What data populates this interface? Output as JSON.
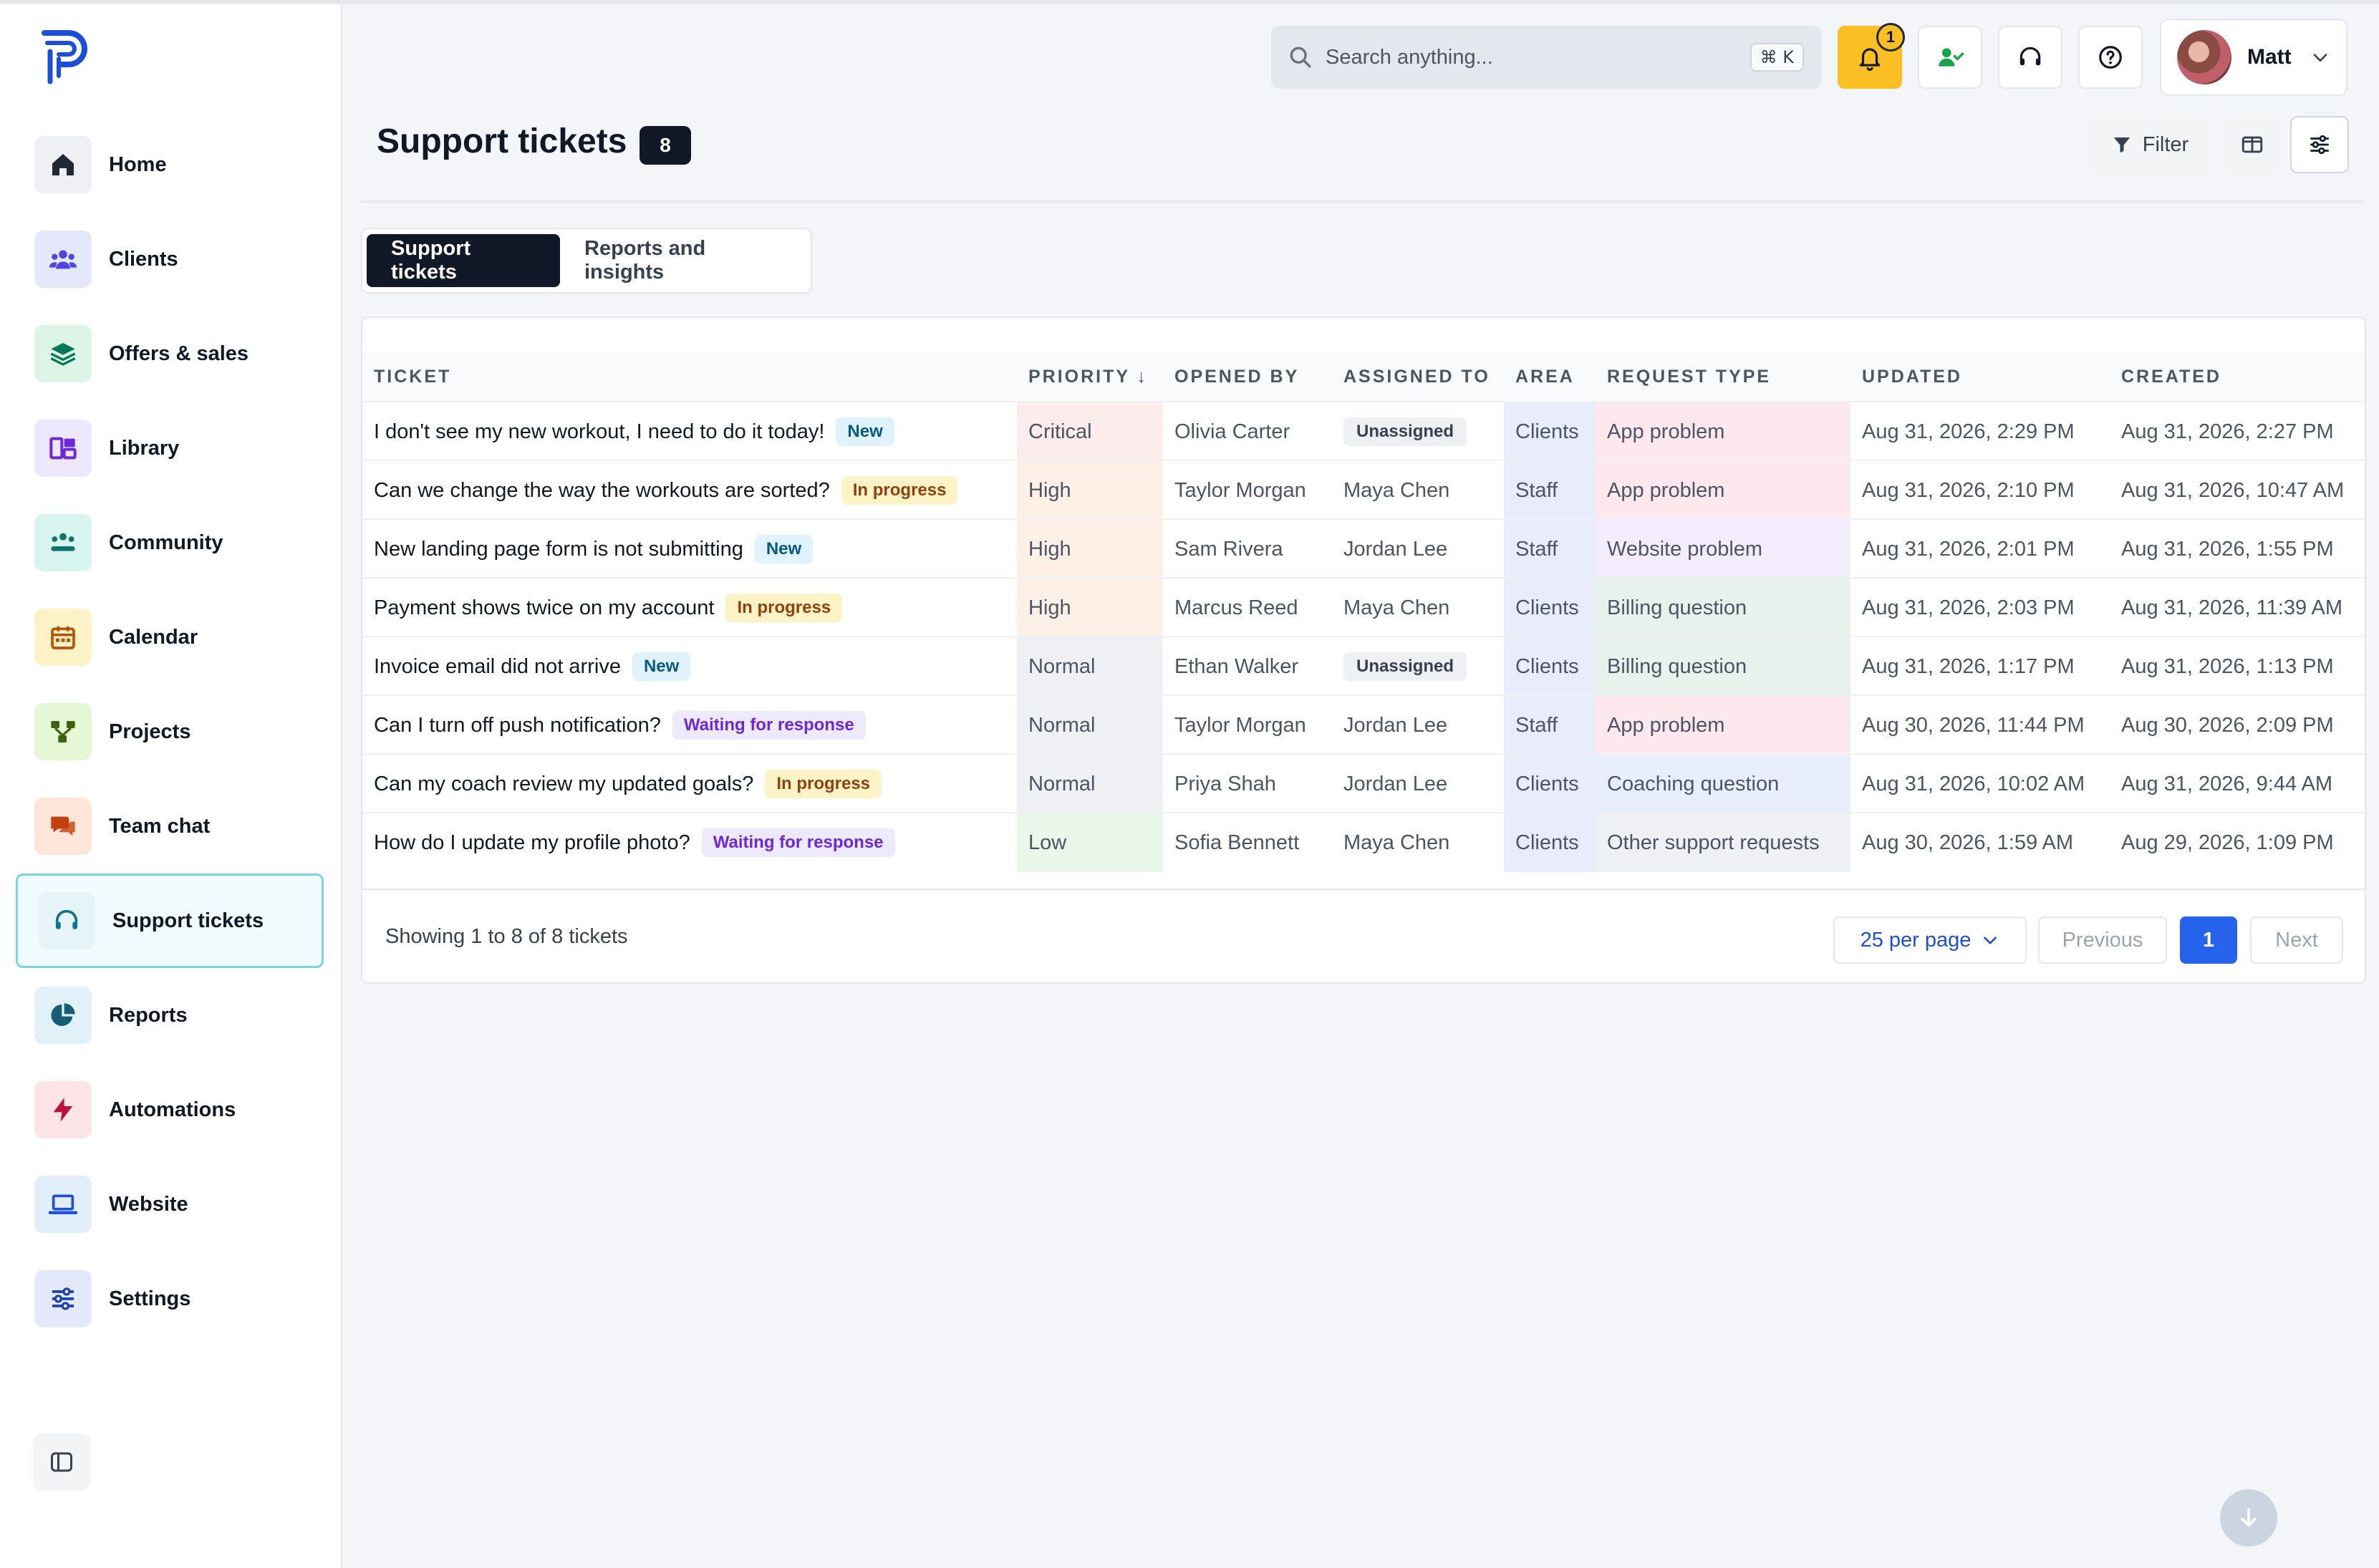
{
  "sidebar": {
    "items": [
      {
        "label": "Home",
        "icon": "home-icon",
        "bg": "#eef0f4",
        "fg": "#1f2937"
      },
      {
        "label": "Clients",
        "icon": "users-icon",
        "bg": "#e4e8fb",
        "fg": "#4f46e5"
      },
      {
        "label": "Offers & sales",
        "icon": "layers-icon",
        "bg": "#dcf5e6",
        "fg": "#047857"
      },
      {
        "label": "Library",
        "icon": "library-icon",
        "bg": "#ede8fb",
        "fg": "#6d28d9"
      },
      {
        "label": "Community",
        "icon": "community-icon",
        "bg": "#d8f6ef",
        "fg": "#0f766e"
      },
      {
        "label": "Calendar",
        "icon": "calendar-icon",
        "bg": "#fdf3c7",
        "fg": "#b45309"
      },
      {
        "label": "Projects",
        "icon": "projects-icon",
        "bg": "#e6f7d6",
        "fg": "#3f6212"
      },
      {
        "label": "Team chat",
        "icon": "chat-icon",
        "bg": "#fde6d8",
        "fg": "#c2410c"
      },
      {
        "label": "Support tickets",
        "icon": "headset-icon",
        "bg": "#e6f4f8",
        "fg": "#0e7490"
      },
      {
        "label": "Reports",
        "icon": "pie-chart-icon",
        "bg": "#e2f1f7",
        "fg": "#155e75"
      },
      {
        "label": "Automations",
        "icon": "bolt-icon",
        "bg": "#fde4e6",
        "fg": "#be123c"
      },
      {
        "label": "Website",
        "icon": "laptop-icon",
        "bg": "#e2eef9",
        "fg": "#1d4ed8"
      },
      {
        "label": "Settings",
        "icon": "sliders-icon",
        "bg": "#e4e8fb",
        "fg": "#1e40af"
      }
    ],
    "active": "Support tickets"
  },
  "topbar": {
    "search_placeholder": "Search anything...",
    "search_shortcut": "⌘ K",
    "notification_count": "1",
    "user_name": "Matt"
  },
  "header": {
    "title": "Support tickets",
    "count": "8",
    "filter_label": "Filter"
  },
  "tabs": [
    {
      "label": "Support tickets",
      "active": true
    },
    {
      "label": "Reports and insights",
      "active": false
    }
  ],
  "table": {
    "columns": [
      "TICKET",
      "PRIORITY ↓",
      "OPENED BY",
      "ASSIGNED TO",
      "AREA",
      "REQUEST TYPE",
      "UPDATED",
      "CREATED"
    ],
    "rows": [
      {
        "ticket": "I don't see my new workout, I need to do it today!",
        "status": "New",
        "priority": "Critical",
        "opened_by": "Olivia Carter",
        "assigned_to": "Unassigned",
        "area": "Clients",
        "request_type": "App problem",
        "updated": "Aug 31, 2026, 2:29 PM",
        "created": "Aug 31, 2026, 2:27 PM"
      },
      {
        "ticket": "Can we change the way the workouts are sorted?",
        "status": "In progress",
        "priority": "High",
        "opened_by": "Taylor Morgan",
        "assigned_to": "Maya Chen",
        "area": "Staff",
        "request_type": "App problem",
        "updated": "Aug 31, 2026, 2:10 PM",
        "created": "Aug 31, 2026, 10:47 AM"
      },
      {
        "ticket": "New landing page form is not submitting",
        "status": "New",
        "priority": "High",
        "opened_by": "Sam Rivera",
        "assigned_to": "Jordan Lee",
        "area": "Staff",
        "request_type": "Website problem",
        "updated": "Aug 31, 2026, 2:01 PM",
        "created": "Aug 31, 2026, 1:55 PM"
      },
      {
        "ticket": "Payment shows twice on my account",
        "status": "In progress",
        "priority": "High",
        "opened_by": "Marcus Reed",
        "assigned_to": "Maya Chen",
        "area": "Clients",
        "request_type": "Billing question",
        "updated": "Aug 31, 2026, 2:03 PM",
        "created": "Aug 31, 2026, 11:39 AM"
      },
      {
        "ticket": "Invoice email did not arrive",
        "status": "New",
        "priority": "Normal",
        "opened_by": "Ethan Walker",
        "assigned_to": "Unassigned",
        "area": "Clients",
        "request_type": "Billing question",
        "updated": "Aug 31, 2026, 1:17 PM",
        "created": "Aug 31, 2026, 1:13 PM"
      },
      {
        "ticket": "Can I turn off push notification?",
        "status": "Waiting for response",
        "priority": "Normal",
        "opened_by": "Taylor Morgan",
        "assigned_to": "Jordan Lee",
        "area": "Staff",
        "request_type": "App problem",
        "updated": "Aug 30, 2026, 11:44 PM",
        "created": "Aug 30, 2026, 2:09 PM"
      },
      {
        "ticket": "Can my coach review my updated goals?",
        "status": "In progress",
        "priority": "Normal",
        "opened_by": "Priya Shah",
        "assigned_to": "Jordan Lee",
        "area": "Clients",
        "request_type": "Coaching question",
        "updated": "Aug 31, 2026, 10:02 AM",
        "created": "Aug 31, 2026, 9:44 AM"
      },
      {
        "ticket": "How do I update my profile photo?",
        "status": "Waiting for response",
        "priority": "Low",
        "opened_by": "Sofia Bennett",
        "assigned_to": "Maya Chen",
        "area": "Clients",
        "request_type": "Other support requests",
        "updated": "Aug 30, 2026, 1:59 AM",
        "created": "Aug 29, 2026, 1:09 PM"
      }
    ],
    "priority_colors": {
      "Critical": "#fdecec",
      "High": "#fdf1e7",
      "Normal": "#eef0f3",
      "Low": "#e9f6ea"
    },
    "area_colors": {
      "Clients": "#e9ecfb",
      "Staff": "#e9ecfb"
    },
    "request_colors": {
      "App problem": "#fde8ee",
      "Website problem": "#f2ecfd",
      "Billing question": "#e8f2ec",
      "Coaching question": "#e8eefb",
      "Other support requests": "#eef0f3"
    }
  },
  "pagination": {
    "showing": "Showing 1 to 8 of 8 tickets",
    "per_page": "25 per page",
    "previous": "Previous",
    "current": "1",
    "next": "Next"
  }
}
